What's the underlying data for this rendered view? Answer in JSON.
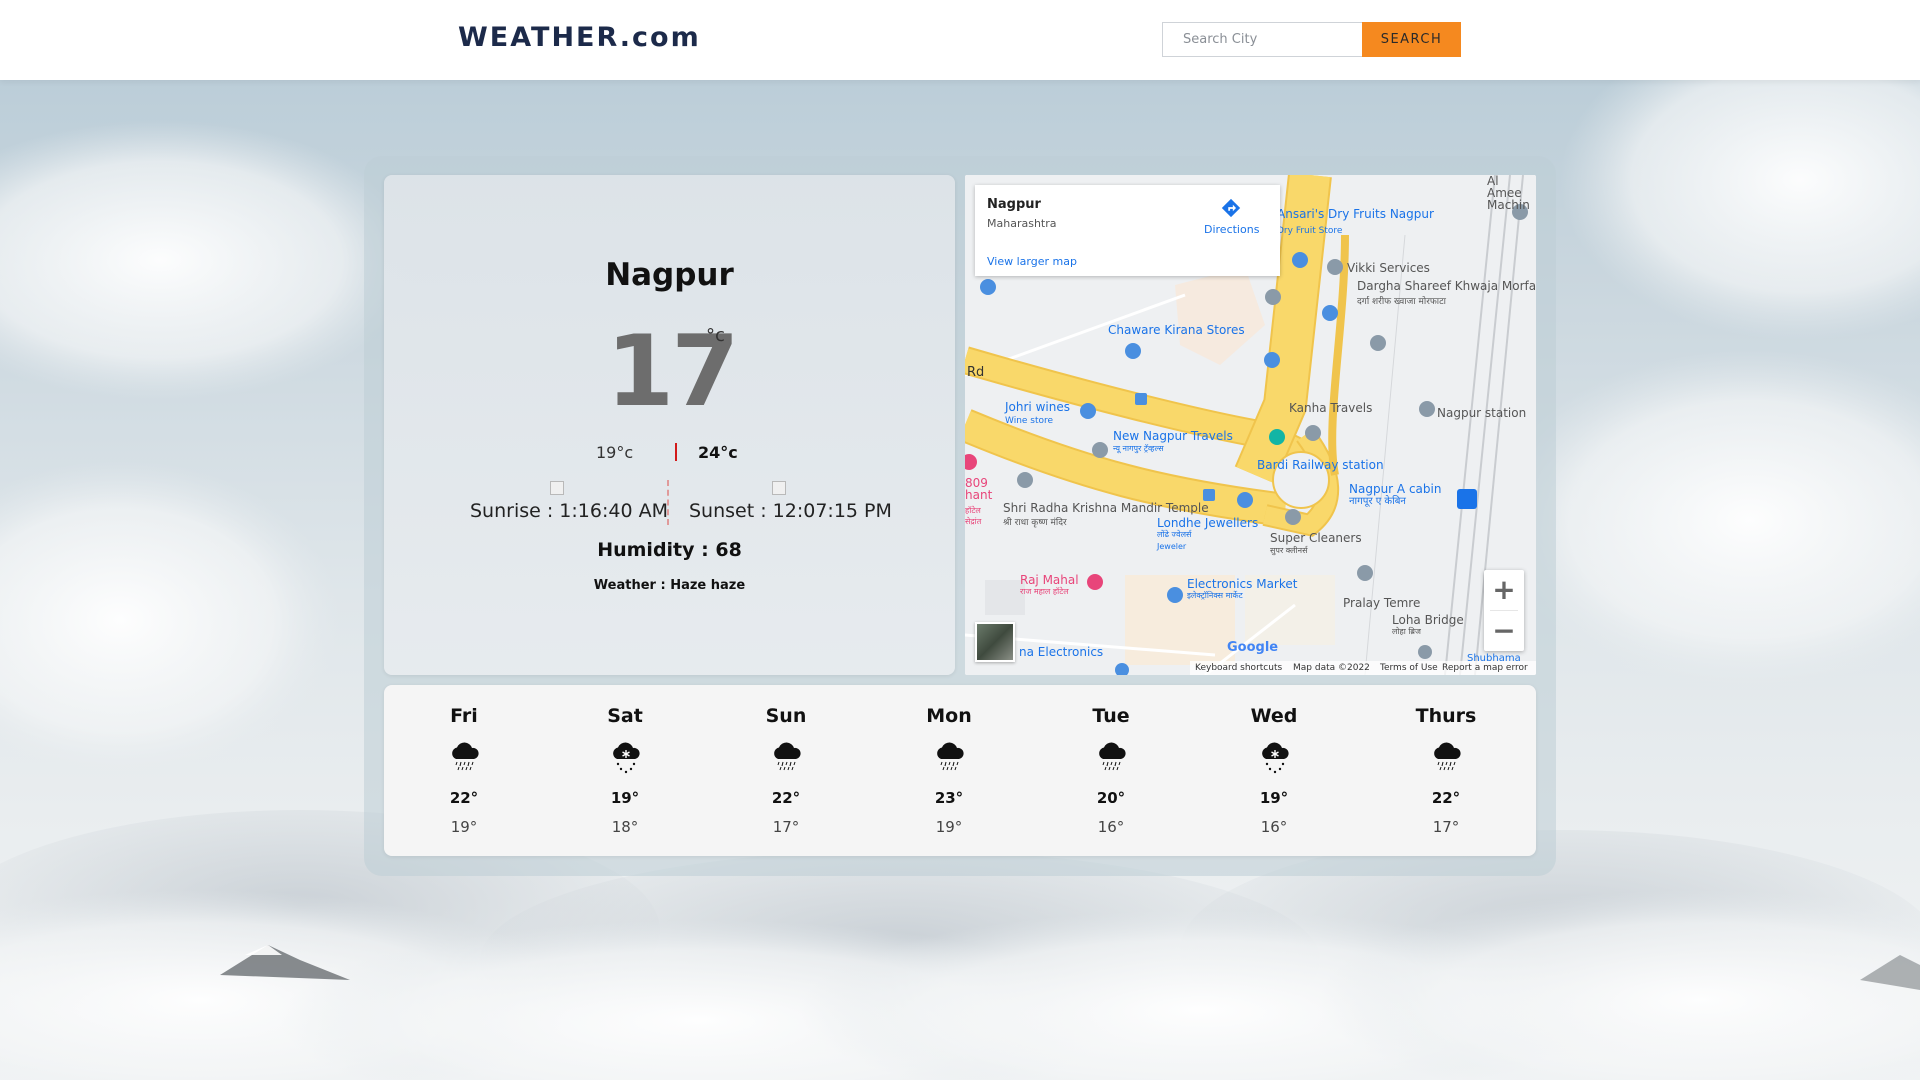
{
  "header": {
    "brand": "WEATHER.com",
    "search_placeholder": "Search City",
    "search_button": "SEARCH"
  },
  "current": {
    "city": "Nagpur",
    "temperature": "17",
    "unit": "°c",
    "min_temp": "19°c",
    "max_temp": "24°c",
    "sunrise": "Sunrise : 1:16:40 AM",
    "sunset": "Sunset : 12:07:15 PM",
    "humidity": "Humidity : 68",
    "weather": "Weather : Haze haze"
  },
  "map": {
    "place_title": "Nagpur",
    "place_subtitle": "Maharashtra",
    "directions": "Directions",
    "view_larger": "View larger map",
    "zoom_in": "+",
    "zoom_out": "−",
    "google": "Google",
    "footer": [
      "Keyboard shortcuts",
      "Map data ©2022",
      "Terms of Use",
      "Report a map error"
    ],
    "labels": [
      "Ansari's Dry Fruits Nagpur",
      "Dry Fruit Store",
      "Vikki Services",
      "Dargha Shareef Khwaja Morfata",
      "दर्गा शरीफ ख्वाजा मोरफाटा",
      "Chaware Kirana Stores",
      "Johri wines",
      "Wine store",
      "Kanha Travels",
      "Nagpur station",
      "New Nagpur Travels",
      "न्यू नागपुर ट्रॅव्हल्स",
      "Bardi Railway station",
      "Shri Radha Krishna Mandir Temple",
      "श्री राधा कृष्ण मंदिर",
      "Nagpur A cabin",
      "नागपूर ए केबिन",
      "Londhe Jewellers",
      "लोंढे ज्वेलर्स",
      "Jeweler",
      "Super Cleaners",
      "सुपर क्लीनर्स",
      "Raj Mahal",
      "राज महाल हॉटेल",
      "Electronics Market",
      "इलेक्ट्रॉनिक्स मार्केट",
      "Pralay Temre",
      "Loha Bridge",
      "लोहा ब्रिज",
      "Rd",
      "809 hant",
      "हॉटेल सेद्रांत",
      "na Electronics",
      "Al Amee Machin",
      "Shubhama"
    ]
  },
  "forecast": [
    {
      "day": "Fri",
      "icon": "rain-cloud-icon",
      "hi": "22°",
      "lo": "19°"
    },
    {
      "day": "Sat",
      "icon": "snow-cloud-icon",
      "hi": "19°",
      "lo": "18°"
    },
    {
      "day": "Sun",
      "icon": "rain-cloud-icon",
      "hi": "22°",
      "lo": "17°"
    },
    {
      "day": "Mon",
      "icon": "rain-cloud-icon",
      "hi": "23°",
      "lo": "19°"
    },
    {
      "day": "Tue",
      "icon": "rain-cloud-icon",
      "hi": "20°",
      "lo": "16°"
    },
    {
      "day": "Wed",
      "icon": "snow-cloud-icon",
      "hi": "19°",
      "lo": "16°"
    },
    {
      "day": "Thurs",
      "icon": "rain-cloud-icon",
      "hi": "22°",
      "lo": "17°"
    }
  ],
  "colors": {
    "accent": "#f5891f",
    "brand": "#1c2a4a",
    "divider_red": "#d21a1a",
    "map_road": "#f9d86a",
    "map_link": "#1a73e8"
  }
}
